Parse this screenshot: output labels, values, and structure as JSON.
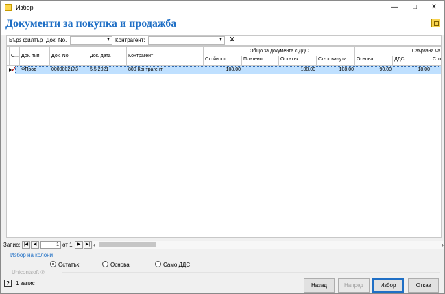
{
  "window": {
    "title": "Избор"
  },
  "page_title": "Документи за покупка и продажба",
  "filter": {
    "quick_filter": "Бърз филтър",
    "doc_no_label": "Док. No.",
    "counterparty_label": "Контрагент:"
  },
  "table": {
    "group_headers": [
      "Общо за документа с ДДС",
      "Свързана ча"
    ],
    "headers": [
      "С...",
      "Док. тип",
      "Док. No.",
      "Док. дата",
      "Контрагент",
      "Стойност",
      "Платено",
      "Остатък",
      "Ст-ст валута",
      "Основа",
      "ДДС",
      "Стой"
    ],
    "rows": [
      {
        "type": "ФПрод",
        "doc_no": "0000002173",
        "date": "5.5.2021",
        "counterparty": "800 Контрагент",
        "value": "108.00",
        "paid": "",
        "remaining": "108.00",
        "currency_value": "108.00",
        "base": "90.00",
        "vat": "18.00",
        "value2": ""
      }
    ]
  },
  "navigation": {
    "label": "Запис:",
    "page": "1",
    "of_text": "от 1"
  },
  "column_selection_link": "Избор на колони",
  "options": [
    {
      "label": "Остатък",
      "selected": true
    },
    {
      "label": "Основа",
      "selected": false
    },
    {
      "label": "Само ДДС",
      "selected": false
    }
  ],
  "brand": "Unicontsoft ®",
  "status": {
    "records": "1 запис"
  },
  "buttons": {
    "back": "Назад",
    "forward": "Напред",
    "choose": "Избор",
    "cancel": "Отказ"
  },
  "colors": {
    "accent": "#1f6fc5",
    "selected_row": "#bfe0ff"
  }
}
